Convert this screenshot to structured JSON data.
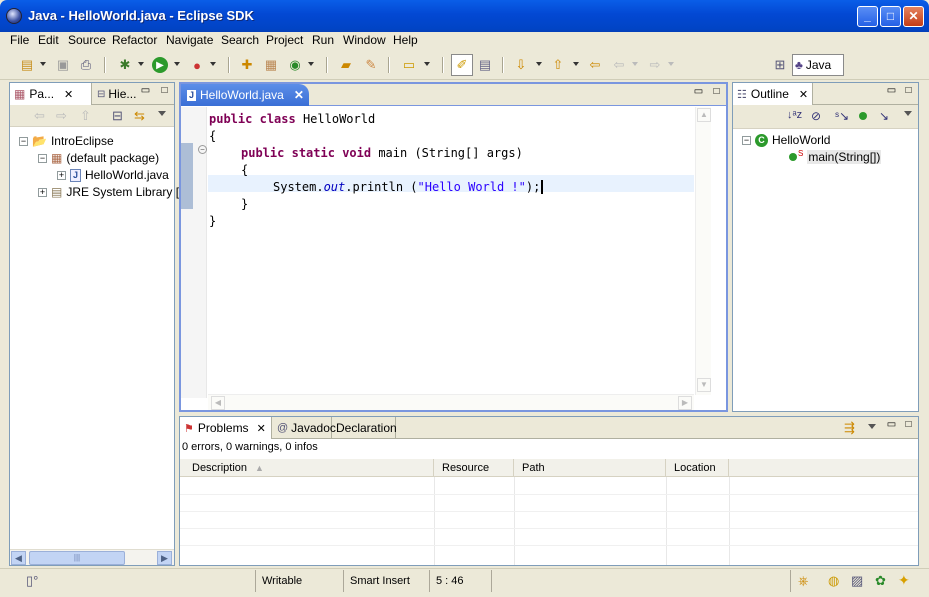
{
  "window": {
    "title": "Java - HelloWorld.java - Eclipse SDK"
  },
  "menu": [
    "File",
    "Edit",
    "Source",
    "Refactor",
    "Navigate",
    "Search",
    "Project",
    "Run",
    "Window",
    "Help"
  ],
  "perspective": {
    "label": "Java"
  },
  "left_panel": {
    "tabs": [
      "Pa...",
      "Hie..."
    ],
    "tree": {
      "project": "IntroEclipse",
      "package": "(default package)",
      "file": "HelloWorld.java",
      "library": "JRE System Library ["
    }
  },
  "editor": {
    "tab": "HelloWorld.java",
    "lines": [
      "public class HelloWorld",
      "{",
      "public static void main (String[] args)",
      "{",
      "System.out.println (\"Hello World !\");",
      "}",
      "}"
    ],
    "tokens": {
      "kw_public": "public",
      "kw_class": "class",
      "class_name": "HelloWorld",
      "kw_static": "static",
      "kw_void": "void",
      "method_sig": "main (String[] args)",
      "sys": "System.",
      "out": "out",
      "println": ".println (",
      "string": "\"Hello World !\"",
      "end": ");"
    }
  },
  "outline": {
    "tab": "Outline",
    "class": "HelloWorld",
    "method": "main(String[])"
  },
  "bottom_panel": {
    "tabs": [
      "Problems",
      "Javadoc",
      "Declaration"
    ],
    "summary": "0 errors, 0 warnings, 0 infos",
    "columns": [
      "Description",
      "Resource",
      "Path",
      "Location"
    ]
  },
  "status": {
    "writable": "Writable",
    "insert_mode": "Smart Insert",
    "position": "5 : 46"
  },
  "colors": {
    "keyword": "#7F0055",
    "string": "#2A00FF",
    "field": "#0000C0",
    "titlebar": "#0A5EE8"
  }
}
